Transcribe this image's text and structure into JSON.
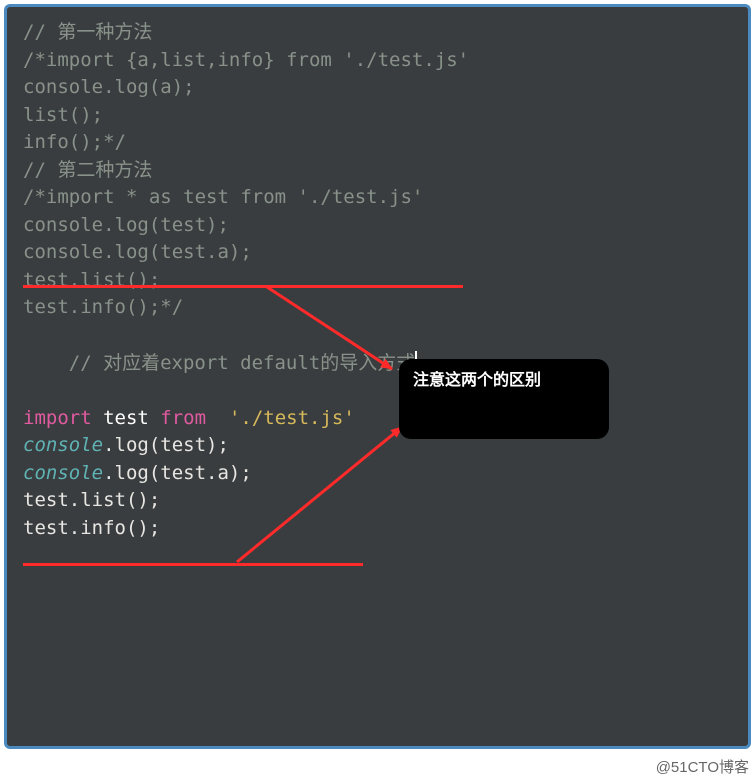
{
  "code": {
    "l1": "// 第一种方法",
    "l2": "/*import {a,list,info} from './test.js'",
    "l3": "",
    "l4": "console.log(a);",
    "l5": "list();",
    "l6": "info();*/",
    "l7": "",
    "l8": "// 第二种方法",
    "l9": "/*import * as test from './test.js'",
    "l10": "",
    "l11": "console.log(test);",
    "l12": "console.log(test.a);",
    "l13": "test.list();",
    "l14": "test.info();*/",
    "l15": "",
    "l16": "",
    "l17_comment": "// 对应着export default的导入方式",
    "l18_import_kw": "import",
    "l18_id": " test ",
    "l18_from_kw": "from",
    "l18_space": "  ",
    "l18_str": "'./test.js'",
    "l19": "",
    "l20_console": "console",
    "l20_rest": ".log(test);",
    "l21_console": "console",
    "l21_rest": ".log(test.a);",
    "l22": "test.list();",
    "l23": "test.info();"
  },
  "callout_text": "注意这两个的区别",
  "watermark": "@51CTO博客"
}
